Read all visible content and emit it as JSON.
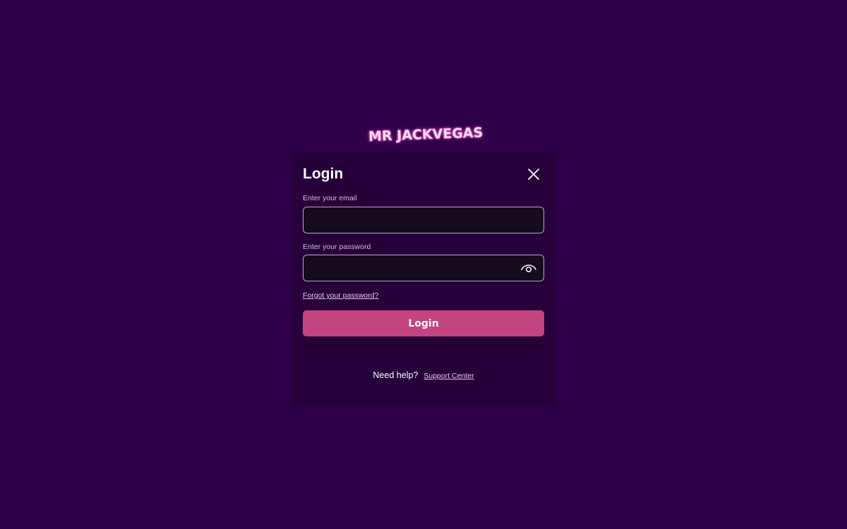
{
  "brand": {
    "logo_text": "MR JACKVEGAS",
    "logo_icon": "cherries-icon",
    "accent_pink": "#ff6ec7"
  },
  "login_modal": {
    "title": "Login",
    "close_icon": "close-icon",
    "email": {
      "label": "Enter your email",
      "value": "",
      "placeholder": ""
    },
    "password": {
      "label": "Enter your password",
      "value": "",
      "placeholder": "",
      "toggle_icon": "eye-icon"
    },
    "forgot_password_link": "Forgot your password?",
    "submit_label": "Login",
    "help_text": "Need help?",
    "support_link": "Support Center"
  },
  "colors": {
    "page_background": "#2e004a",
    "modal_background": "#250039",
    "input_background": "#150b1c",
    "button_primary": "#c4447f",
    "text_primary": "#ffffff"
  }
}
